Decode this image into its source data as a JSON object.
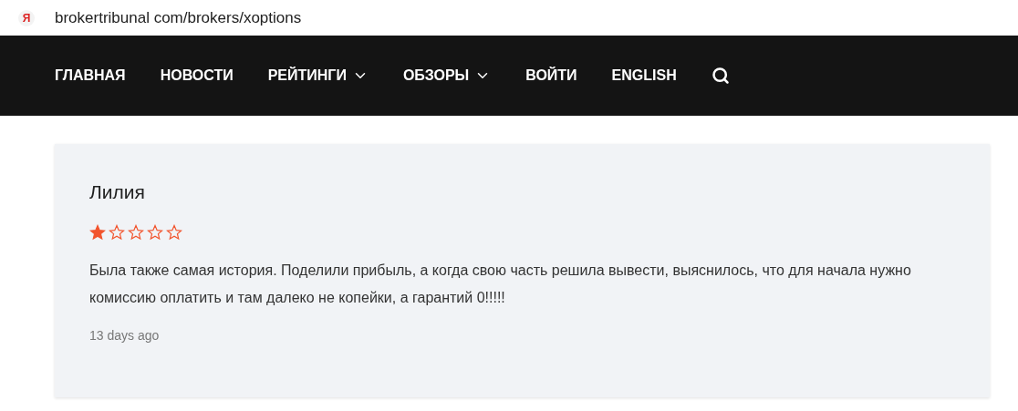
{
  "address_bar": {
    "favicon": "Я",
    "url": "brokertribunal com/brokers/xoptions"
  },
  "nav": {
    "items": [
      {
        "label": "ГЛАВНАЯ",
        "dropdown": false
      },
      {
        "label": "НОВОСТИ",
        "dropdown": false
      },
      {
        "label": "РЕЙТИНГИ",
        "dropdown": true
      },
      {
        "label": "ОБЗОРЫ",
        "dropdown": true
      },
      {
        "label": "ВОЙТИ",
        "dropdown": false
      },
      {
        "label": "ENGLISH",
        "dropdown": false
      }
    ]
  },
  "review": {
    "author": "Лилия",
    "stars": 1,
    "text": "Была также самая история. Поделили прибыль, а когда свою часть решила вывести, выяснилось, что для начала нужно комиссию оплатить и там далеко не копейки, а гарантий 0!!!!!",
    "date": "13 days ago"
  }
}
